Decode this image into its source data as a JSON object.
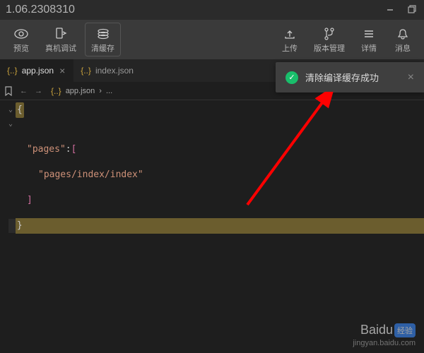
{
  "titlebar": {
    "version": "1.06.2308310"
  },
  "toolbar": {
    "left": [
      {
        "label": "预览",
        "icon": "eye"
      },
      {
        "label": "真机调试",
        "icon": "phone"
      },
      {
        "label": "清缓存",
        "icon": "stack"
      }
    ],
    "right": [
      {
        "label": "上传",
        "icon": "upload"
      },
      {
        "label": "版本管理",
        "icon": "branch"
      },
      {
        "label": "详情",
        "icon": "menu"
      },
      {
        "label": "消息",
        "icon": "bell"
      }
    ]
  },
  "tabs": [
    {
      "name": "app.json",
      "active": true
    },
    {
      "name": "index.json",
      "active": false
    }
  ],
  "breadcrumb": {
    "file": "app.json",
    "sep": "›",
    "more": "..."
  },
  "code": {
    "open_brace": "{",
    "key_pages": "\"pages\"",
    "colon": ":",
    "open_bracket": "[",
    "page_path": "\"pages/index/index\"",
    "close_bracket": "]",
    "close_brace": "}"
  },
  "notification": {
    "text": "清除编译缓存成功"
  },
  "watermark": {
    "logo": "Baidu",
    "badge": "经验",
    "url": "jingyan.baidu.com"
  }
}
